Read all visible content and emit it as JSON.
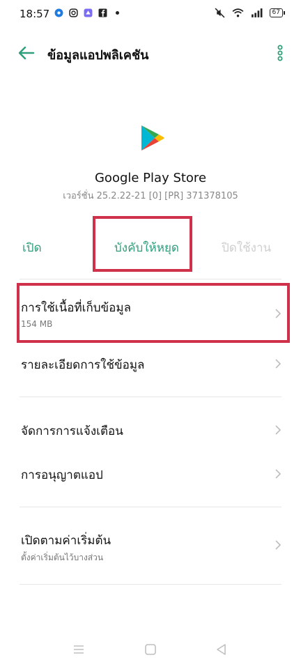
{
  "status_bar": {
    "time": "18:57",
    "battery": "67",
    "left_icons": [
      "messenger-icon",
      "instagram-icon",
      "app-icon",
      "facebook-icon",
      "dot-icon"
    ],
    "right_icons": [
      "mute-icon",
      "wifi-icon",
      "signal-icon",
      "battery-icon"
    ]
  },
  "header": {
    "title": "ข้อมูลแอปพลิเคชัน",
    "back_icon": "back-arrow-icon",
    "more_icon": "more-vert-icon"
  },
  "app": {
    "name": "Google Play Store",
    "version": "เวอร์ชั่น 25.2.22-21 [0] [PR] 371378105",
    "icon": "play-store-icon"
  },
  "actions": {
    "open": "เปิด",
    "force_stop": "บังคับให้หยุด",
    "disable": "ปิดใช้งาน"
  },
  "rows": {
    "storage": {
      "title": "การใช้เนื้อที่เก็บข้อมูล",
      "subtitle": "154 MB"
    },
    "data_usage": {
      "title": "รายละเอียดการใช้ข้อมูล"
    },
    "notifications": {
      "title": "จัดการการแจ้งเตือน"
    },
    "permissions": {
      "title": "การอนุญาตแอป"
    },
    "open_by_default": {
      "title": "เปิดตามค่าเริ่มต้น",
      "subtitle": "ตั้งค่าเริ่มต้นไว้บางส่วน"
    }
  },
  "colors": {
    "accent": "#2f9e7a",
    "highlight": "#d0314a",
    "disabled": "#cfcfcf"
  },
  "nav": [
    "menu-icon",
    "home-icon",
    "back-triangle-icon"
  ]
}
